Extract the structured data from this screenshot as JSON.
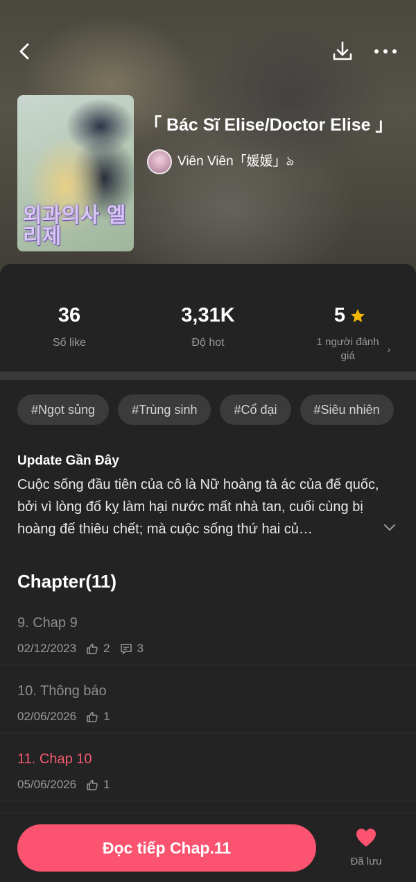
{
  "header": {
    "title": "「 Bác Sĩ Elise/Doctor Elise 」",
    "author": "Viên Viên「媛媛」ঌ",
    "cover_logo_text": "외과의사 엘리제"
  },
  "stats": {
    "likes_value": "36",
    "likes_label": "Số like",
    "hot_value": "3,31K",
    "hot_label": "Độ hot",
    "rating_value": "5",
    "rating_label": "1 người đánh giá"
  },
  "tags": [
    "#Ngọt sủng",
    "#Trùng sinh",
    "#Cổ đại",
    "#Siêu nhiên"
  ],
  "update": {
    "title": "Update Gần Đây",
    "body": "Cuộc sống đầu tiên của cô là Nữ hoàng tà ác của đế quốc, bởi vì lòng đố kỵ làm hại nước mất nhà tan, cuối cùng bị hoàng đế thiêu chết; mà cuộc sống thứ hai củ…"
  },
  "chapters_heading": "Chapter(11)",
  "chapters": [
    {
      "name": "9. Chap 9",
      "date": "02/12/2023",
      "likes": "2",
      "comments": "3",
      "active": false
    },
    {
      "name": "10. Thông báo",
      "date": "02/06/2026",
      "likes": "1",
      "comments": null,
      "active": false
    },
    {
      "name": "11. Chap 10",
      "date": "05/06/2026",
      "likes": "1",
      "comments": null,
      "active": true
    }
  ],
  "bottom": {
    "read_label": "Đọc tiếp Chap.11",
    "saved_label": "Đã lưu"
  },
  "colors": {
    "accent": "#fb5370",
    "active_chapter": "#f25a6e",
    "star": "#f5b800"
  }
}
